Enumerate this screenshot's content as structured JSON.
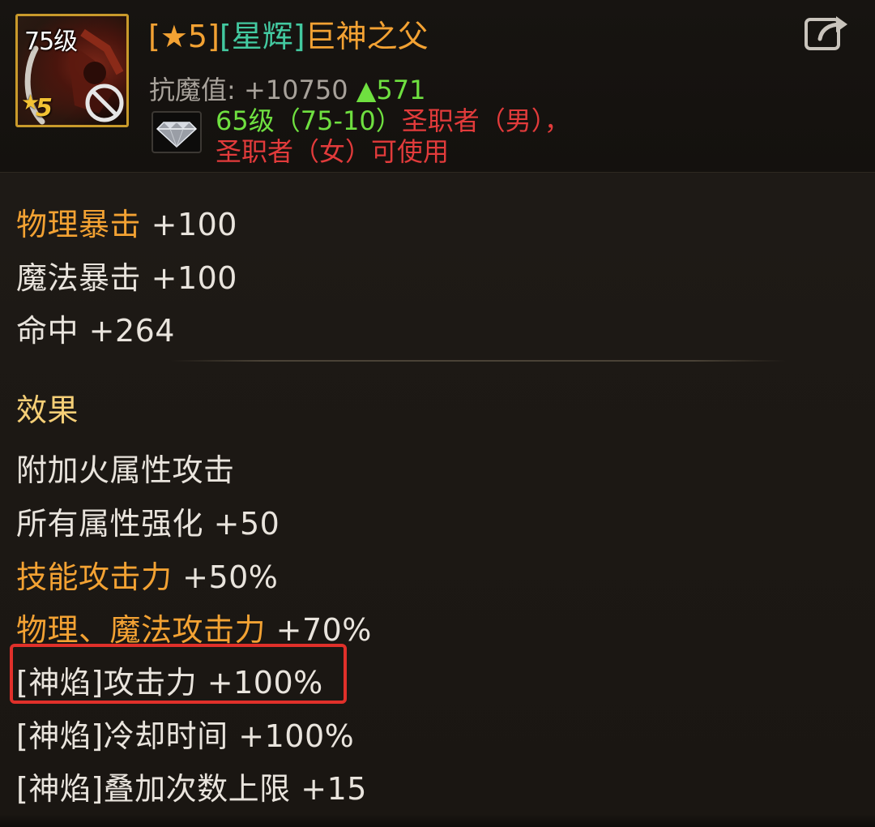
{
  "item": {
    "level_badge": "75级",
    "star_badge": "5",
    "title_star_segment": "★5",
    "title_tag": "星辉",
    "title_name": "巨神之父"
  },
  "resistance": {
    "label": "抗魔值:",
    "value": "+10750",
    "gain": "▲571"
  },
  "requirement": {
    "level": "65级（75-10）",
    "class_text_1": "圣职者（男），",
    "class_text_2": "圣职者（女）可使用"
  },
  "stats": [
    {
      "name": "物理暴击",
      "value": "+100"
    },
    {
      "name": "魔法暴击",
      "value": "+100"
    },
    {
      "name": "命中",
      "value": "+264"
    }
  ],
  "effects": {
    "title": "效果",
    "items": [
      {
        "text": "附加火属性攻击"
      },
      {
        "name": "所有属性强化",
        "value": "+50"
      },
      {
        "name": "技能攻击力",
        "value": "+50%"
      },
      {
        "name": "物理、魔法攻击力",
        "value": "+70%"
      },
      {
        "name": "[神焰]攻击力",
        "value": "+100%"
      },
      {
        "name": "[神焰]冷却时间",
        "value": "+100%"
      },
      {
        "name": "[神焰]叠加次数上限",
        "value": "+15"
      }
    ]
  },
  "colors": {
    "accent_orange": "#f3a233",
    "tag_green": "#43c9a0",
    "gain_green": "#6fe040",
    "requirement_red": "#e23b3b",
    "section_gold": "#f5cf77",
    "highlight_red": "#e0302a"
  },
  "icons": {
    "export": "export-icon",
    "gem": "diamond-gem-icon",
    "no_entry": "no-entry-icon"
  }
}
